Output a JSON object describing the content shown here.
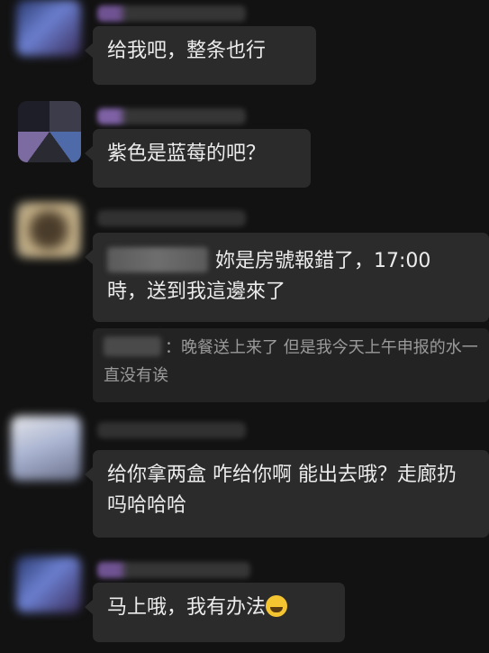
{
  "messages": [
    {
      "text": "给我吧，整条也行"
    },
    {
      "text": "紫色是蓝莓的吧？"
    },
    {
      "text": "妳是房號報錯了，17:00 時，送到我這邊來了",
      "quote": "：晚餐送上来了 但是我今天上午申报的水一直没有诶"
    },
    {
      "text": "给你拿两盒 咋给你啊 能出去哦？走廊扔吗哈哈哈"
    },
    {
      "text": "马上哦，我有办法",
      "emoji_icon": "face-with-tears-of-joy"
    }
  ],
  "colors": {
    "background": "#121212",
    "bubble": "#2b2b2b",
    "quote_bubble": "#232323",
    "text": "#ececec",
    "quote_text": "#9a9a9a"
  }
}
